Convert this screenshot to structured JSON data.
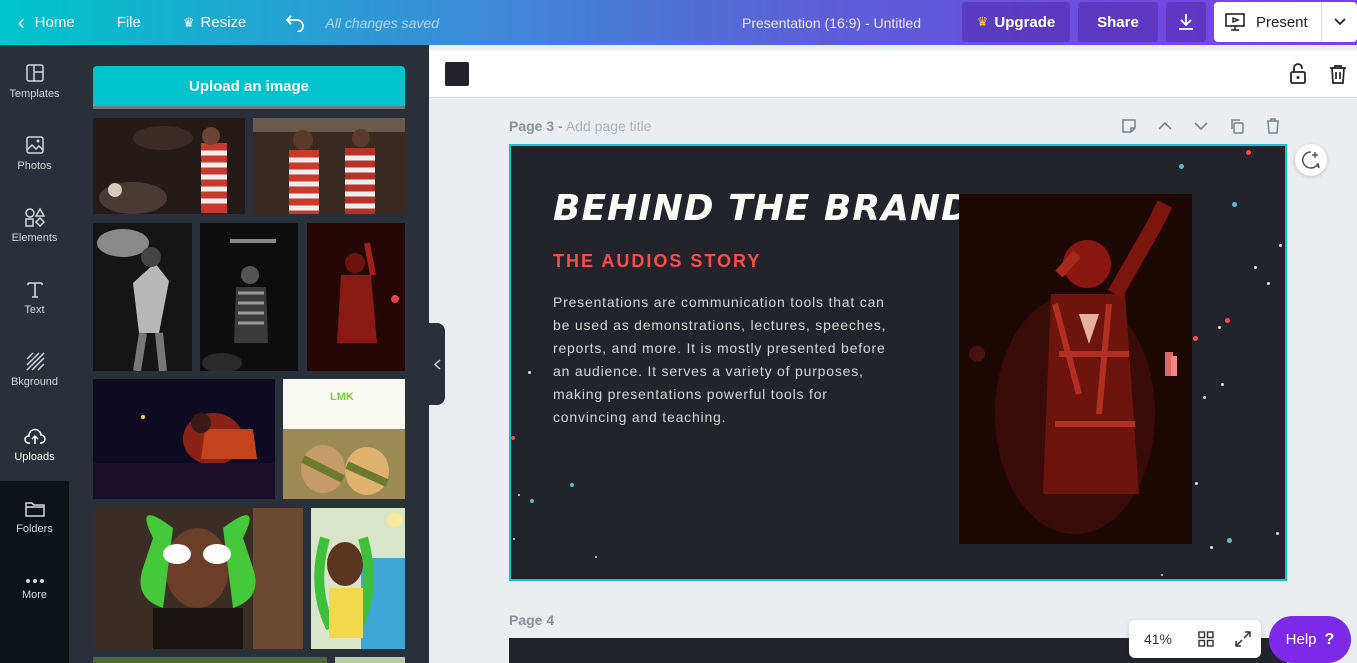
{
  "topbar": {
    "home": "Home",
    "file": "File",
    "resize": "Resize",
    "saved_status": "All changes saved",
    "doc_title": "Presentation (16:9) - Untitled",
    "upgrade": "Upgrade",
    "share": "Share",
    "present": "Present"
  },
  "sidebar": {
    "items": [
      {
        "label": "Templates",
        "icon": "templates-icon"
      },
      {
        "label": "Photos",
        "icon": "photos-icon"
      },
      {
        "label": "Elements",
        "icon": "elements-icon"
      },
      {
        "label": "Text",
        "icon": "text-icon"
      },
      {
        "label": "Bkground",
        "icon": "background-icon"
      },
      {
        "label": "Uploads",
        "icon": "uploads-icon"
      },
      {
        "label": "Folders",
        "icon": "folders-icon"
      },
      {
        "label": "More",
        "icon": "more-icon"
      }
    ]
  },
  "panel": {
    "upload_button": "Upload an image"
  },
  "pages": {
    "page3_label": "Page 3 -",
    "page3_title_placeholder": "Add page title",
    "page4_label": "Page 4"
  },
  "slide": {
    "title": "BEHIND THE BRAND",
    "subtitle": "THE AUDIOS STORY",
    "body": "Presentations are communication tools that can be used as demonstrations, lectures, speeches, reports, and more. It is mostly presented before an audience. It serves a variety of purposes, making presentations powerful tools for convincing and teaching."
  },
  "thumb_text": {
    "lmk": "LMK"
  },
  "zoom": {
    "level": "41%"
  },
  "help": {
    "label": "Help",
    "mark": "?"
  },
  "colors": {
    "accent": "#00c4cc",
    "slide_bg": "#23242b",
    "slide_subtitle": "#ff4a4a",
    "help": "#7d2ae8"
  }
}
